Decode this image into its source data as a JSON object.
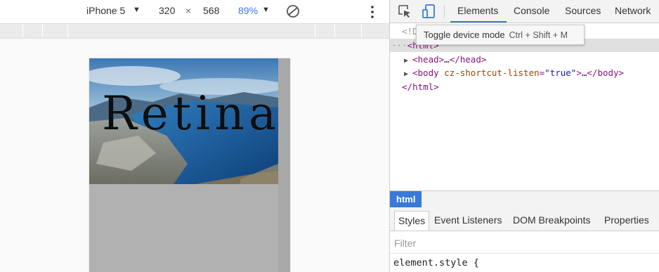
{
  "device_toolbar": {
    "device": "iPhone 5",
    "width": "320",
    "times": "×",
    "height": "568",
    "zoom": "89%",
    "icons": [
      "chevron-down-icon",
      "rotate-icon",
      "more-vertical-icon"
    ]
  },
  "page": {
    "hero_title": "Retina"
  },
  "devtools": {
    "tabs": [
      "Elements",
      "Console",
      "Sources",
      "Network"
    ],
    "active_tab": "Elements",
    "accent_color": "#3879d9",
    "tooltip": {
      "label": "Toggle device mode",
      "shortcut": "Ctrl + Shift + M"
    },
    "dom": {
      "doctype_fragment": "<!D",
      "html_open": "<html>",
      "head_line": {
        "open": "<head>",
        "ellipsis": "…",
        "close": "</head>"
      },
      "body_line": {
        "open": "<body",
        "attr_name": "cz-shortcut-listen",
        "eq": "=",
        "attr_value": "\"true\"",
        "gt": ">",
        "ellipsis": "…",
        "close": "</body>"
      },
      "html_close": "</html>",
      "selected_dots": "···"
    },
    "breadcrumb": [
      "html"
    ],
    "sidebar_tabs": [
      "Styles",
      "Event Listeners",
      "DOM Breakpoints",
      "Properties"
    ],
    "active_sidebar_tab": "Styles",
    "filter_placeholder": "Filter",
    "style_rule": "element.style {"
  }
}
